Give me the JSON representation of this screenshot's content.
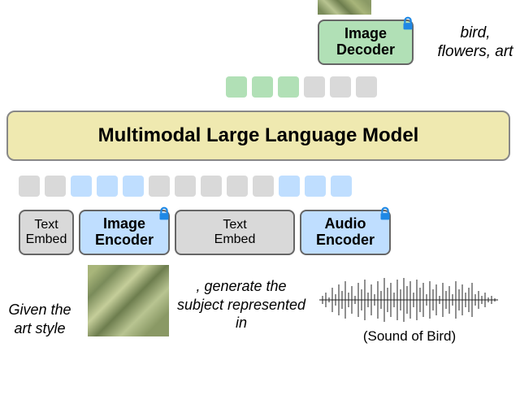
{
  "decoder": {
    "line1": "Image",
    "line2": "Decoder"
  },
  "output_tags": "bird, flowers, art",
  "llm_title": "Multimodal Large Language Model",
  "encoders": {
    "text_embed1_line1": "Text",
    "text_embed1_line2": "Embed",
    "image_enc_line1": "Image",
    "image_enc_line2": "Encoder",
    "text_embed2_line1": "Text",
    "text_embed2_line2": "Embed",
    "audio_enc_line1": "Audio",
    "audio_enc_line2": "Encoder"
  },
  "captions": {
    "left": "Given the art style",
    "mid": ", generate the subject represented in",
    "sound": "(Sound of Bird)"
  },
  "tokens": {
    "top": [
      "green",
      "green",
      "green",
      "grey",
      "grey",
      "grey"
    ],
    "bottom": [
      "grey",
      "grey",
      "blue",
      "blue",
      "blue",
      "grey",
      "grey",
      "grey",
      "grey",
      "grey",
      "blue",
      "blue",
      "blue"
    ]
  },
  "colors": {
    "green": "#b1e0b6",
    "blue": "#bfdeff",
    "grey": "#d9d9d9",
    "yellow": "#efe9b0",
    "lock": "#1e88e5"
  }
}
